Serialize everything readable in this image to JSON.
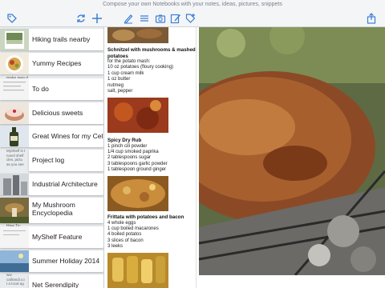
{
  "toolbar": {
    "tagline": "Compose your own Notebooks with your notes, ideas, pictures, snippets",
    "icons": [
      "tag-icon",
      "sync-icon",
      "add-icon",
      "pencil-icon",
      "list-icon",
      "camera-icon",
      "edit-note-icon",
      "tag-plus-icon",
      "share-icon"
    ]
  },
  "notes": [
    {
      "title": "Hiking trails nearby"
    },
    {
      "title": "Yummy Recipes"
    },
    {
      "title": "To do"
    },
    {
      "title": "Delicious sweets"
    },
    {
      "title": "Great Wines for my Cellar"
    },
    {
      "title": "Project log"
    },
    {
      "title": "Industrial Architecture"
    },
    {
      "title": "My Mushroom Encyclopedia"
    },
    {
      "title": "MyShelf Feature"
    },
    {
      "title": "Summer Holiday 2014"
    },
    {
      "title": "Net Serendipity"
    }
  ],
  "thumb_labels": {
    "make_new": "make new d",
    "how_to": "How To:",
    "myshelf": "MyShelf is t\nnovel shelf\ncles, pictu\nas you see",
    "calli": "ww.\ncallrandi.co\nt a local ag"
  },
  "recipes": [
    {
      "title": "Schnitzel with mushrooms & mashed potatoes",
      "lines": [
        "for the potato mash:",
        "10 oz potatoes (floury cooking)",
        "1 cup cream milk",
        "1 oz butter",
        "nutmeg",
        "salt, pepper"
      ]
    },
    {
      "title": "Spicy Dry Rub",
      "lines": [
        "1 pinch cili powder",
        "1/4 cup smoked paprika",
        "2 tablespoons sugar",
        "3 tablespoons garlic powder",
        "1 tablespoon ground ginger"
      ]
    },
    {
      "title": "Frittata with potatoes and bacon",
      "lines": [
        "4 whole eggs",
        "1 cup boiled macarones",
        "4 boiled potatos",
        "3 slices of bacon",
        "3 leeks"
      ]
    }
  ],
  "colors": {
    "accent": "#3b7fd4",
    "toolbar_bg": "#f4f5f7",
    "list_bg": "#e9ecef"
  }
}
